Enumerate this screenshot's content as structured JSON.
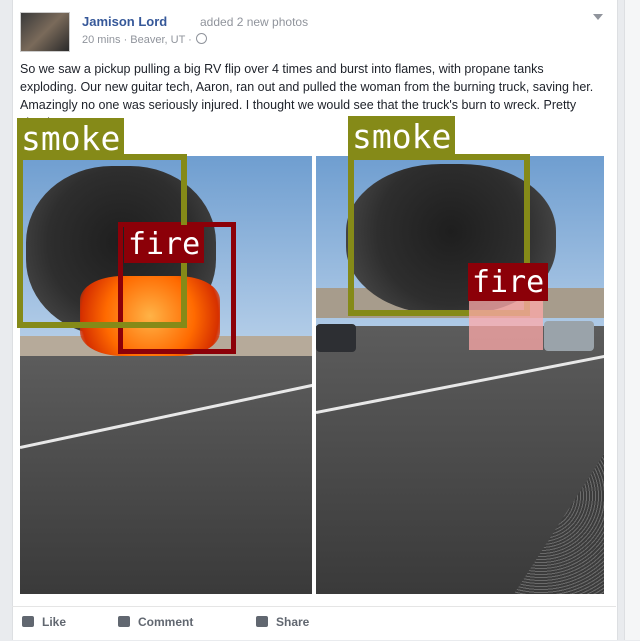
{
  "post": {
    "author": "Jamison Lord",
    "action": "added 2 new photos",
    "meta": "20 mins · Beaver, UT ·",
    "text": "So we saw a pickup pulling a big RV flip over 4 times and burst into flames, with propane tanks exploding. Our new guitar tech, Aaron, ran out and pulled the woman from the burning truck, saving her. Amazingly no one was seriously injured. I thought we would see that the truck's burn to wreck. Pretty shook us up."
  },
  "detections": {
    "left": {
      "smoke_label": "smoke",
      "fire_label": "fire"
    },
    "right": {
      "smoke_label": "smoke",
      "fire_label": "fire"
    }
  },
  "actions": {
    "like": "Like",
    "comment": "Comment",
    "share": "Share"
  },
  "colors": {
    "smoke_box": "#858a18",
    "fire_box": "#8c0008",
    "link": "#365899"
  }
}
